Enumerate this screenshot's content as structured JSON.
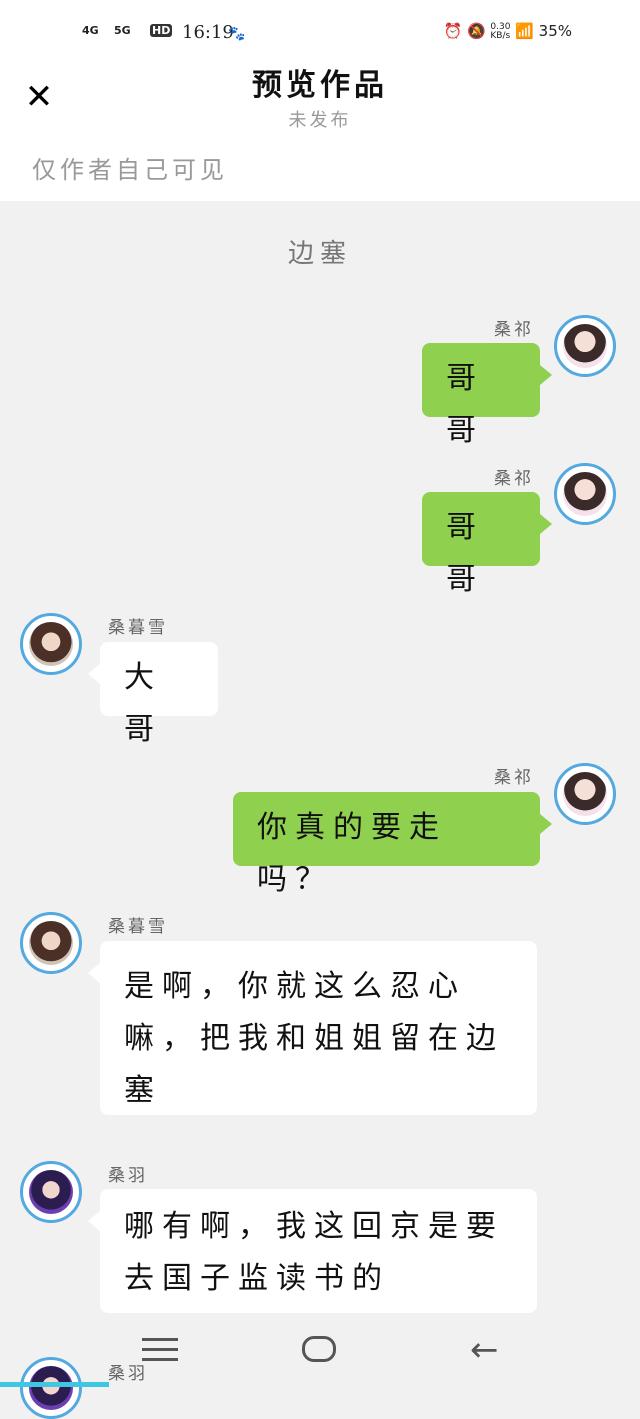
{
  "status_bar": {
    "signal_4g": "4G",
    "signal_5g": "5G",
    "hd": "HD",
    "time": "16:19",
    "speed": "0.30 KB/s",
    "battery": "35%"
  },
  "header": {
    "title": "预览作品",
    "subtitle": "未发布",
    "notice": "仅作者自己可见"
  },
  "chapter_title": "边塞",
  "messages": [
    {
      "speaker": "桑祁",
      "text": "哥哥",
      "side": "right"
    },
    {
      "speaker": "桑祁",
      "text": "哥哥",
      "side": "right"
    },
    {
      "speaker": "桑暮雪",
      "text": "大哥",
      "side": "left"
    },
    {
      "speaker": "桑祁",
      "text": "你真的要走吗？",
      "side": "right"
    },
    {
      "speaker": "桑暮雪",
      "text": "是啊，你就这么忍心嘛，把我和姐姐留在边塞",
      "side": "left"
    },
    {
      "speaker": "桑羽",
      "text": "哪有啊，我这回京是要去国子监读书的",
      "side": "left"
    },
    {
      "speaker": "桑羽",
      "text": "",
      "side": "left"
    }
  ],
  "reading_progress": 0.17,
  "colors": {
    "right_bubble": "#8fd14f",
    "left_bubble": "#ffffff",
    "avatar_ring": "#53a9e0",
    "progress": "#3fc6e0",
    "background": "#f1f1f1"
  }
}
